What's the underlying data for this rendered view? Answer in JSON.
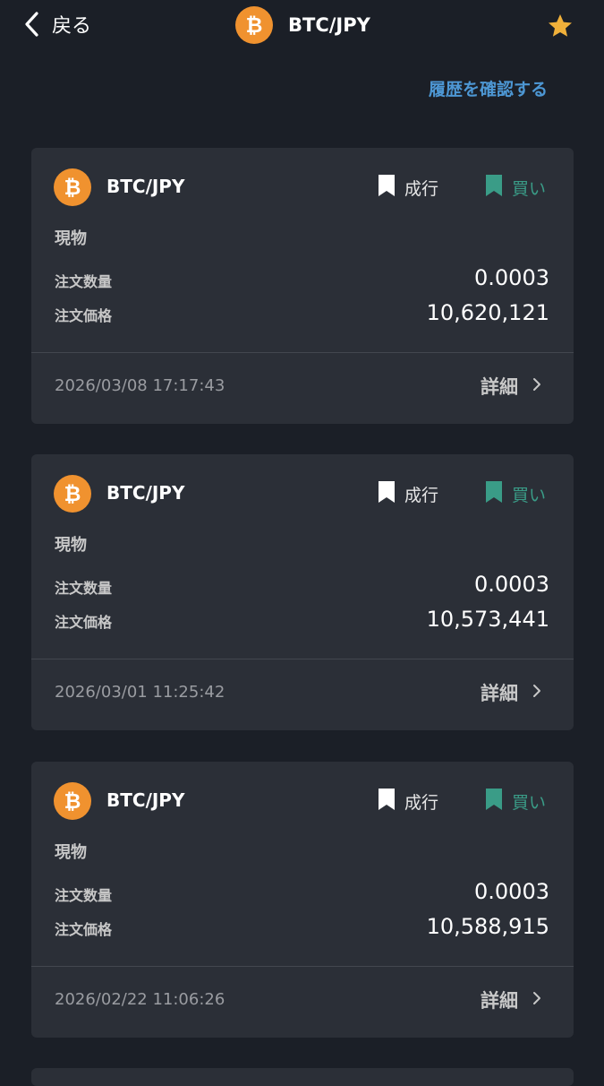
{
  "header": {
    "back_label": "戻る",
    "title": "BTC/JPY",
    "coin_icon": "bitcoin-icon",
    "star_icon": "star-icon",
    "star_color": "#f0b03a"
  },
  "history_link": "履歴を確認する",
  "colors": {
    "background": "#1b1f27",
    "card": "#2b2f37",
    "accent_link": "#4d97d4",
    "buy": "#3a9c87",
    "bitcoin": "#f0922f"
  },
  "orders": [
    {
      "pair": "BTC/JPY",
      "order_type": "成行",
      "side": "買い",
      "category": "現物",
      "quantity_label": "注文数量",
      "quantity": "0.0003",
      "price_label": "注文価格",
      "price": "10,620,121",
      "datetime": "2026/03/08 17:17:43",
      "detail_label": "詳細"
    },
    {
      "pair": "BTC/JPY",
      "order_type": "成行",
      "side": "買い",
      "category": "現物",
      "quantity_label": "注文数量",
      "quantity": "0.0003",
      "price_label": "注文価格",
      "price": "10,573,441",
      "datetime": "2026/03/01 11:25:42",
      "detail_label": "詳細"
    },
    {
      "pair": "BTC/JPY",
      "order_type": "成行",
      "side": "買い",
      "category": "現物",
      "quantity_label": "注文数量",
      "quantity": "0.0003",
      "price_label": "注文価格",
      "price": "10,588,915",
      "datetime": "2026/02/22 11:06:26",
      "detail_label": "詳細"
    }
  ]
}
